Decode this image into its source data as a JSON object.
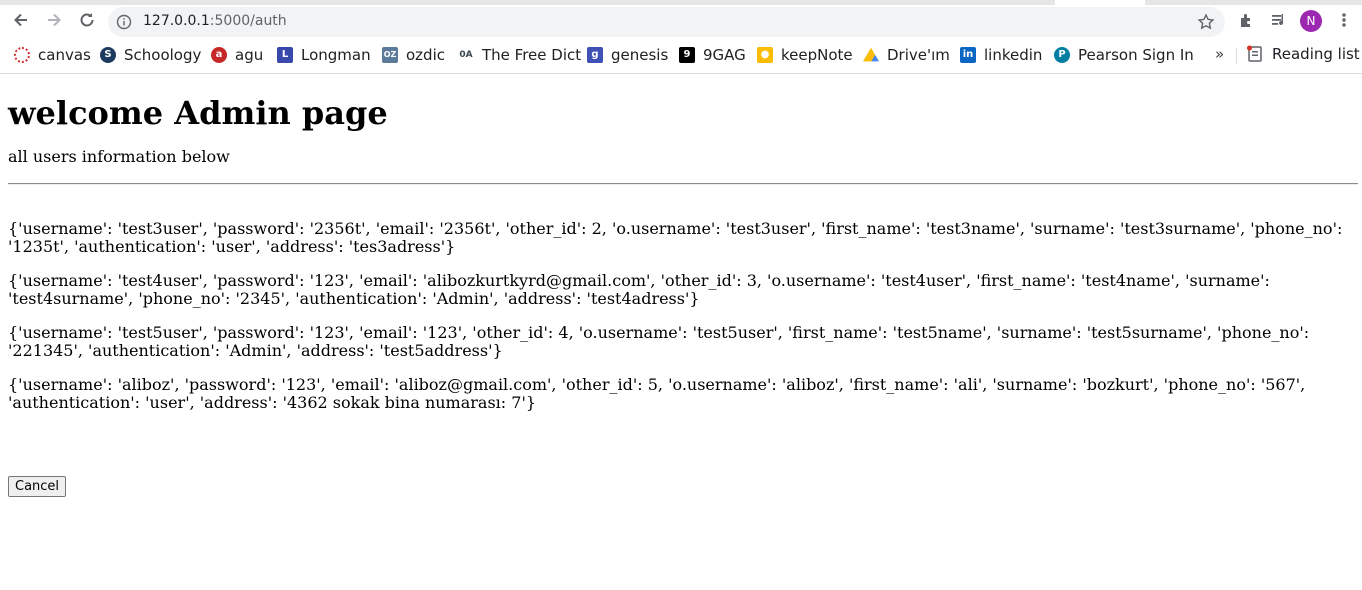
{
  "browser": {
    "url_host": "127.0.0.1",
    "url_rest": ":5000/auth",
    "profile_initial": "N",
    "bookmarks": [
      {
        "label": "canvas",
        "icon": "canvas-icon",
        "color": "#d32f2f"
      },
      {
        "label": "Schoology",
        "icon": "schoology-icon",
        "color": "#1e3a5f"
      },
      {
        "label": "agu",
        "icon": "agu-icon",
        "color": "#c62828"
      },
      {
        "label": "Longman",
        "icon": "longman-icon",
        "color": "#3949ab"
      },
      {
        "label": "ozdic",
        "icon": "ozdic-icon",
        "color": "#5c7a99"
      },
      {
        "label": "The Free Dict",
        "icon": "freedict-icon",
        "color": "#37474f"
      },
      {
        "label": "genesis",
        "icon": "genesis-icon",
        "color": "#3f51b5"
      },
      {
        "label": "9GAG",
        "icon": "9gag-icon",
        "color": "#000000"
      },
      {
        "label": "keepNote",
        "icon": "keep-icon",
        "color": "#fbbc04"
      },
      {
        "label": "Drive'ım",
        "icon": "drive-icon",
        "color": "#34a853"
      },
      {
        "label": "linkedin",
        "icon": "linkedin-icon",
        "color": "#0a66c2"
      },
      {
        "label": "Pearson Sign In",
        "icon": "pearson-icon",
        "color": "#007fa3"
      }
    ],
    "overflow": "»",
    "reading_list": "Reading list"
  },
  "page": {
    "title": "welcome Admin page",
    "subtitle": "all users information below",
    "records": [
      "{'username': 'test3user', 'password': '2356t', 'email': '2356t', 'other_id': 2, 'o.username': 'test3user', 'first_name': 'test3name', 'surname': 'test3surname', 'phone_no': '1235t', 'authentication': 'user', 'address': 'tes3adress'}",
      "{'username': 'test4user', 'password': '123', 'email': 'alibozkurtkyrd@gmail.com', 'other_id': 3, 'o.username': 'test4user', 'first_name': 'test4name', 'surname': 'test4surname', 'phone_no': '2345', 'authentication': 'Admin', 'address': 'test4adress'}",
      "{'username': 'test5user', 'password': '123', 'email': '123', 'other_id': 4, 'o.username': 'test5user', 'first_name': 'test5name', 'surname': 'test5surname', 'phone_no': '221345', 'authentication': 'Admin', 'address': 'test5address'}",
      "{'username': 'aliboz', 'password': '123', 'email': 'aliboz@gmail.com', 'other_id': 5, 'o.username': 'aliboz', 'first_name': 'ali', 'surname': 'bozkurt', 'phone_no': '567', 'authentication': 'user', 'address': '4362 sokak bina numarası: 7'}"
    ],
    "cancel_label": "Cancel"
  }
}
